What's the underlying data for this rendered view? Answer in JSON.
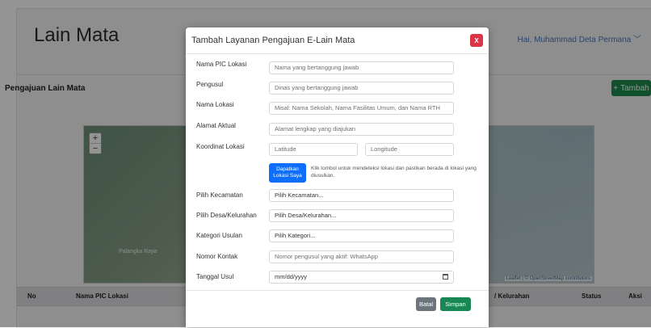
{
  "app": {
    "title": "Lain Mata",
    "user_menu": "Hai, Muhammad Deta Permana",
    "user_menu_chevron": "﹀"
  },
  "page": {
    "section_title": "Pengajuan Lain Mata",
    "add_button_label": "Tambah",
    "add_button_icon": "+"
  },
  "map": {
    "zoom_in": "+",
    "zoom_out": "−",
    "place_label": "Palangka Raya",
    "attribution": "Leaflet | © OpenStreetMap contributors"
  },
  "table": {
    "columns": [
      "No",
      "Nama PIC Lokasi",
      "/ Kelurahan",
      "Status",
      "Aksi"
    ]
  },
  "modal": {
    "title": "Tambah Layanan Pengajuan E-Lain Mata",
    "close_label": "X",
    "fields": {
      "pic": {
        "label": "Nama PIC Lokasi",
        "placeholder": "Nama yang bertanggung jawab"
      },
      "pengusul": {
        "label": "Pengusul",
        "placeholder": "Dinas yang bertanggung jawab"
      },
      "lokasi": {
        "label": "Nama Lokasi",
        "placeholder": "Misal: Nama Sekolah, Nama Fasilitas Umum, dan Nama RTH"
      },
      "alamat": {
        "label": "Alamat Aktual",
        "placeholder": "Alamat lengkap yang diajukan"
      },
      "koordinat": {
        "label": "Koordinat Lokasi",
        "lat_placeholder": "Latitude",
        "lng_placeholder": "Longitude"
      },
      "detect": {
        "button_line1": "Dapatkan",
        "button_line2": "Lokasi Saya",
        "help": "Klik tombol untuk mendeteksi lokasi dan pastikan berada di lokasi yang diusulkan."
      },
      "kecamatan": {
        "label": "Pilih Kecamatan",
        "value": "Pilih Kecamatan..."
      },
      "desa": {
        "label": "Pilih Desa/Kelurahan",
        "value": "Pilih Desa/Kelurahan..."
      },
      "kategori": {
        "label": "Kategori Usulan",
        "value": "Pilih Kategori..."
      },
      "kontak": {
        "label": "Nomor Kontak",
        "placeholder": "Nomor pengusul yang aktif: WhatsApp"
      },
      "tanggal": {
        "label": "Tanggal Usul",
        "value": "mm/dd/yyyy"
      }
    },
    "buttons": {
      "cancel": "Batal",
      "save": "Simpan"
    }
  },
  "colors": {
    "primary": "#0d6efd",
    "success": "#198754",
    "danger": "#dc3545",
    "secondary": "#6c757d"
  }
}
